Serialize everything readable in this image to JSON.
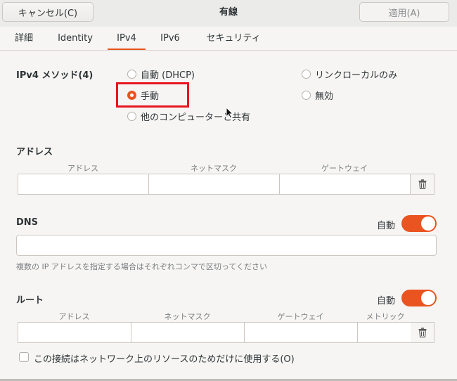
{
  "header": {
    "cancel_label": "キャンセル(C)",
    "title": "有線",
    "apply_label": "適用(A)"
  },
  "tabs": [
    {
      "label": "詳細"
    },
    {
      "label": "Identity"
    },
    {
      "label": "IPv4"
    },
    {
      "label": "IPv6"
    },
    {
      "label": "セキュリティ"
    }
  ],
  "method": {
    "label": "IPv4 メソッド(4)",
    "options": [
      {
        "label": "自動 (DHCP)"
      },
      {
        "label": "リンクローカルのみ"
      },
      {
        "label": "手動"
      },
      {
        "label": "無効"
      },
      {
        "label": "他のコンピューターと共有"
      }
    ],
    "selected": "手動"
  },
  "address": {
    "title": "アドレス",
    "columns": [
      "アドレス",
      "ネットマスク",
      "ゲートウェイ"
    ]
  },
  "dns": {
    "title": "DNS",
    "auto_label": "自動",
    "auto_on": true,
    "hint": "複数の IP アドレスを指定する場合はそれぞれコンマで区切ってください"
  },
  "route": {
    "title": "ルート",
    "auto_label": "自動",
    "auto_on": true,
    "columns": [
      "アドレス",
      "ネットマスク",
      "ゲートウェイ",
      "メトリック"
    ]
  },
  "only_local": {
    "label": "この接続はネットワーク上のリソースのためだけに使用する(O)",
    "checked": false
  },
  "icons": {
    "delete": "trash-icon",
    "cursor": "mouse-pointer-icon"
  },
  "colors": {
    "accent": "#e95420",
    "highlight": "#e5161d"
  }
}
